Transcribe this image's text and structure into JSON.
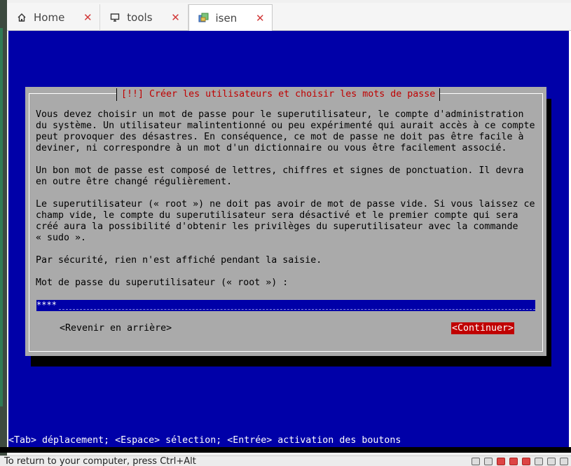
{
  "tabs": [
    {
      "label": "Home",
      "icon": "home-icon",
      "active": false
    },
    {
      "label": "tools",
      "icon": "monitor-icon",
      "active": false
    },
    {
      "label": "isen",
      "icon": "vm-icon",
      "active": true
    }
  ],
  "dialog": {
    "title": "[!!] Créer les utilisateurs et choisir les mots de passe",
    "paragraphs": [
      "Vous devez choisir un mot de passe pour le superutilisateur, le compte d'administration\ndu système. Un utilisateur malintentionné ou peu expérimenté qui aurait accès à ce compte\npeut provoquer des désastres. En conséquence, ce mot de passe ne doit pas être facile à\ndeviner, ni correspondre à un mot d'un dictionnaire ou vous être facilement associé.",
      "Un bon mot de passe est composé de lettres, chiffres et signes de ponctuation. Il devra\nen outre être changé régulièrement.",
      "Le superutilisateur (« root ») ne doit pas avoir de mot de passe vide. Si vous laissez ce\nchamp vide, le compte du superutilisateur sera désactivé et le premier compte qui sera\ncréé aura la possibilité d'obtenir les privilèges du superutilisateur avec la commande\n« sudo ».",
      "Par sécurité, rien n'est affiché pendant la saisie.",
      "Mot de passe du superutilisateur (« root ») :"
    ],
    "password_value": "****",
    "back_button": "<Revenir en arrière>",
    "continue_button": "<Continuer>"
  },
  "console_help": "<Tab> déplacement; <Espace> sélection; <Entrée> activation des boutons",
  "status_hint": "To return to your computer, press Ctrl+Alt",
  "colors": {
    "console_bg": "#0000a8",
    "dialog_bg": "#aaaaaa",
    "title_red": "#c00000",
    "tab_close": "#d23a3a"
  }
}
